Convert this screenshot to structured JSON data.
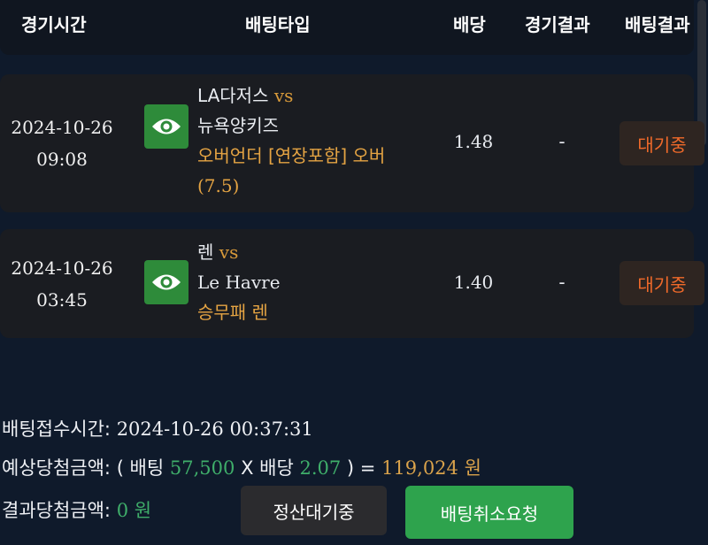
{
  "header": {
    "col_time": "경기시간",
    "col_type": "배팅타입",
    "col_odds": "배당",
    "col_game_result": "경기결과",
    "col_bet_result": "배팅결과"
  },
  "bets": [
    {
      "date": "2024-10-26",
      "time": "09:08",
      "home": "LA다저스",
      "vs": "vs",
      "away": "뉴욕양키즈",
      "pick_line1": "오버언더 [연장포함] 오버",
      "pick_line2": "(7.5)",
      "odds": "1.48",
      "game_result": "-",
      "status": "대기중"
    },
    {
      "date": "2024-10-26",
      "time": "03:45",
      "home": "렌",
      "vs": "vs",
      "away": "Le Havre",
      "pick_line1": "승무패 렌",
      "odds": "1.40",
      "game_result": "-",
      "status": "대기중"
    }
  ],
  "summary": {
    "received_label": "배팅접수시간:",
    "received_value": "2024-10-26 00:37:31",
    "expected_label": "예상당첨금액:",
    "expected_open": "( 배팅",
    "stake": "57,500",
    "times": "X 배당",
    "total_odds": "2.07",
    "close_eq": ") =",
    "payout": "119,024",
    "won": "원",
    "actual_label": "결과당첨금액:",
    "actual_value": "0",
    "actual_won": "원"
  },
  "buttons": {
    "pending": "정산대기중",
    "cancel": "배팅취소요청"
  },
  "colors": {
    "eye_bg": "#2e8b3a",
    "status_text": "#f06a2a",
    "cancel_bg": "#2ea34d"
  },
  "icons": {
    "view": "eye-icon"
  }
}
